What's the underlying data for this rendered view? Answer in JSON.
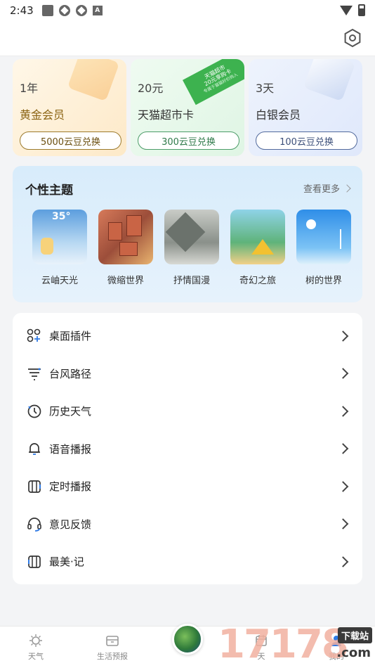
{
  "status_bar": {
    "time": "2:43",
    "notification_badge": "A"
  },
  "memberships": [
    {
      "duration": "1年",
      "name": "黄金会员",
      "button": "5000云豆兑换"
    },
    {
      "duration": "20元",
      "name": "天猫超市卡",
      "button": "300云豆兑换",
      "ribbon_line1": "天猫超市",
      "ribbon_line2": "20元享购卡",
      "ribbon_sub": "专属于猫猫好价购入"
    },
    {
      "duration": "3天",
      "name": "白银会员",
      "button": "100云豆兑换"
    }
  ],
  "themes": {
    "title": "个性主题",
    "more": "查看更多",
    "items": [
      {
        "label": "云岫天光",
        "temp": "35°"
      },
      {
        "label": "微缩世界"
      },
      {
        "label": "抒情国漫"
      },
      {
        "label": "奇幻之旅"
      },
      {
        "label": "树的世界"
      }
    ]
  },
  "menu": [
    {
      "label": "桌面插件",
      "icon": "widget-icon"
    },
    {
      "label": "台风路径",
      "icon": "typhoon-icon"
    },
    {
      "label": "历史天气",
      "icon": "history-clock-icon"
    },
    {
      "label": "语音播报",
      "icon": "bell-icon"
    },
    {
      "label": "定时播报",
      "icon": "timer-icon"
    },
    {
      "label": "意见反馈",
      "icon": "headset-icon"
    },
    {
      "label": "最美·记",
      "icon": "journal-icon"
    }
  ],
  "bottom_nav": [
    {
      "label": "天气",
      "icon": "sun-icon"
    },
    {
      "label": "生活预报",
      "icon": "box-icon"
    },
    {
      "label": "",
      "icon": "radar-globe-icon"
    },
    {
      "label": "天",
      "icon": "calendar-icon"
    },
    {
      "label": "我的",
      "icon": "profile-icon"
    }
  ],
  "watermark": {
    "text": "17178",
    "tag": "下载站",
    "sub": ".com"
  }
}
